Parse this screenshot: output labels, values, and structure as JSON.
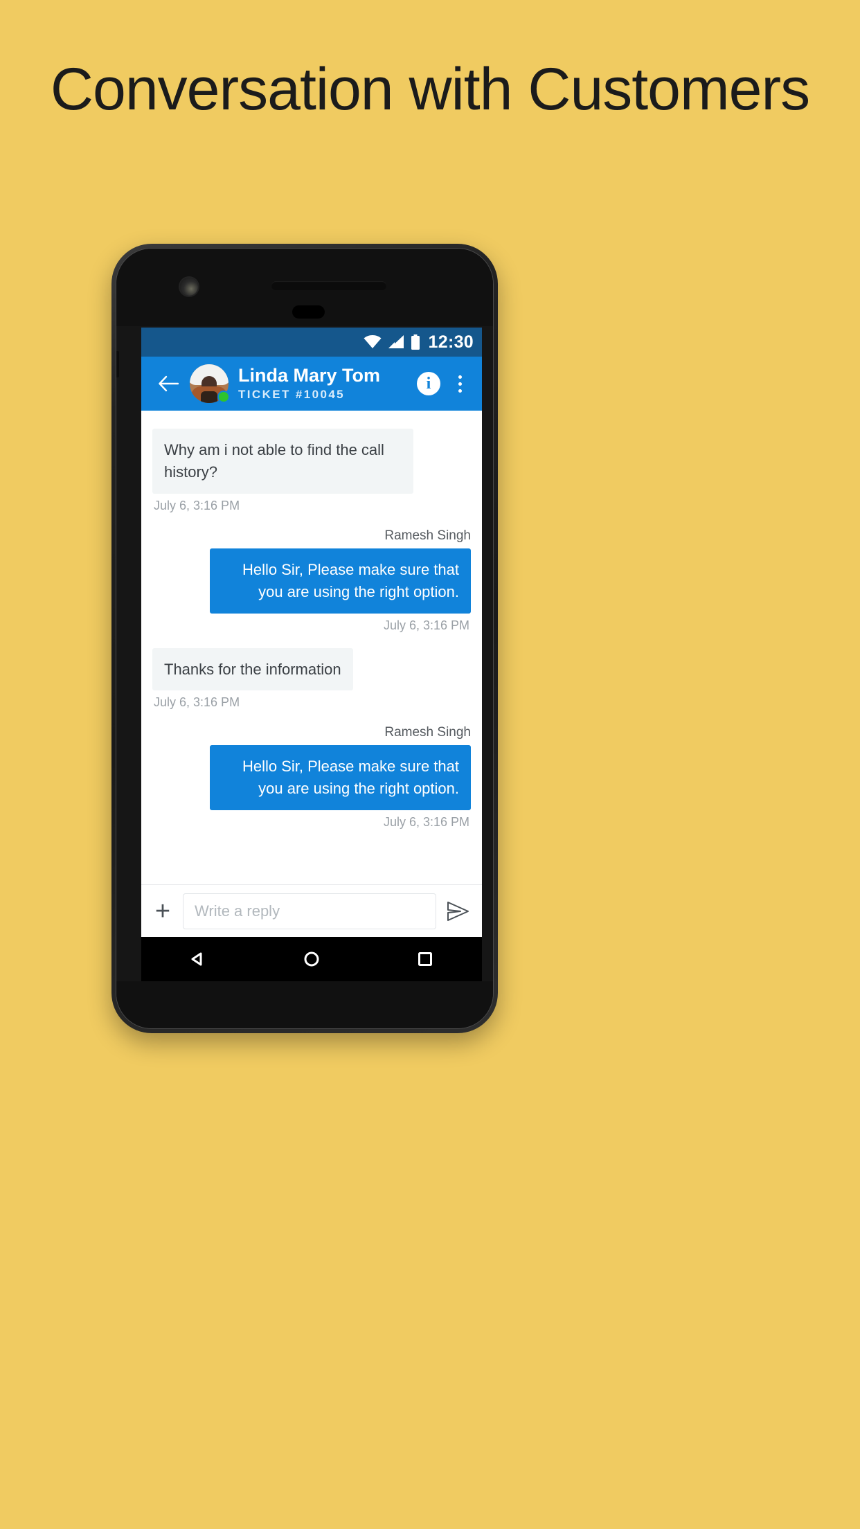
{
  "headline": "Conversation with Customers",
  "background_color": "#f0cb61",
  "accent_color": "#1183da",
  "statusbar": {
    "time": "12:30",
    "icons": [
      "wifi-icon",
      "signal-icon",
      "battery-icon"
    ]
  },
  "appbar": {
    "back_icon": "back-arrow-icon",
    "contact_name": "Linda Mary Tom",
    "ticket_id": "TICKET #10045",
    "info_label": "i",
    "presence": "online",
    "menu_icon": "overflow-menu-icon"
  },
  "messages": [
    {
      "direction": "in",
      "sender": "",
      "text": "Why am i not able to find the call history?",
      "timestamp": "July 6, 3:16 PM"
    },
    {
      "direction": "out",
      "sender": "Ramesh Singh",
      "text": "Hello Sir, Please make sure that you are using the right option.",
      "timestamp": "July 6, 3:16 PM"
    },
    {
      "direction": "in",
      "sender": "",
      "text": "Thanks for the information",
      "timestamp": "July 6, 3:16 PM"
    },
    {
      "direction": "out",
      "sender": "Ramesh Singh",
      "text": "Hello Sir, Please make sure that you are using the right option.",
      "timestamp": "July 6, 3:16 PM"
    }
  ],
  "composer": {
    "attach_icon": "plus-icon",
    "placeholder": "Write a reply",
    "value": "",
    "send_icon": "send-icon"
  },
  "navbar": {
    "back": "triangle-back-icon",
    "home": "circle-home-icon",
    "recents": "square-recents-icon"
  }
}
